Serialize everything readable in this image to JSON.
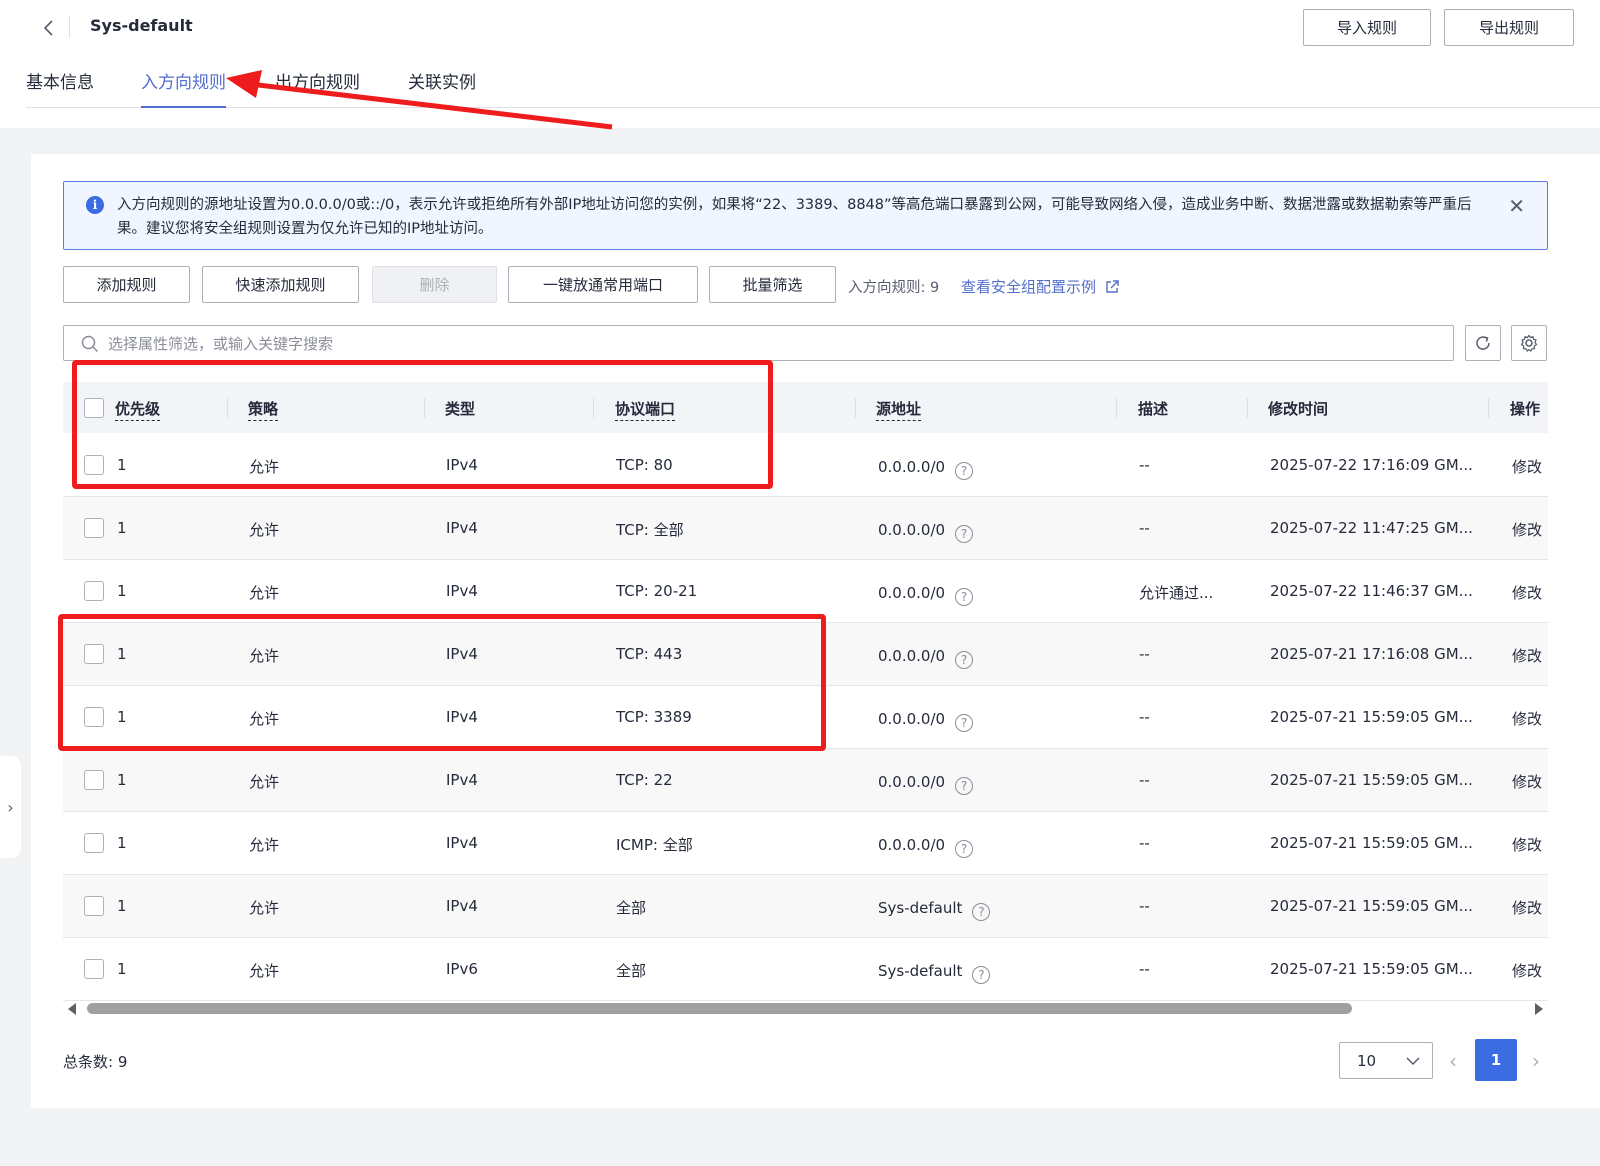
{
  "header": {
    "title": "Sys-default",
    "import_label": "导入规则",
    "export_label": "导出规则"
  },
  "tabs": [
    {
      "label": "基本信息"
    },
    {
      "label": "入方向规则"
    },
    {
      "label": "出方向规则"
    },
    {
      "label": "关联实例"
    }
  ],
  "alert": {
    "text": "入方向规则的源地址设置为0.0.0.0/0或::/0，表示允许或拒绝所有外部IP地址访问您的实例，如果将“22、3389、8848”等高危端口暴露到公网，可能导致网络入侵，造成业务中断、数据泄露或数据勒索等严重后果。建议您将安全组规则设置为仅允许已知的IP地址访问。"
  },
  "toolbar": {
    "add_label": "添加规则",
    "quick_add_label": "快速添加规则",
    "delete_label": "删除",
    "open_ports_label": "一键放通常用端口",
    "batch_filter_label": "批量筛选",
    "rule_count": "入方向规则: 9",
    "example_link": "查看安全组配置示例"
  },
  "search": {
    "placeholder": "选择属性筛选，或输入关键字搜索"
  },
  "table": {
    "columns": [
      "优先级",
      "策略",
      "类型",
      "协议端口",
      "源地址",
      "描述",
      "修改时间",
      "操作"
    ],
    "rows": [
      {
        "priority": "1",
        "policy": "允许",
        "type": "IPv4",
        "port": "TCP: 80",
        "source": "0.0.0.0/0",
        "desc": "--",
        "time": "2025-07-22 17:16:09 GM...",
        "action": "修改"
      },
      {
        "priority": "1",
        "policy": "允许",
        "type": "IPv4",
        "port": "TCP: 全部",
        "source": "0.0.0.0/0",
        "desc": "--",
        "time": "2025-07-22 11:47:25 GM...",
        "action": "修改"
      },
      {
        "priority": "1",
        "policy": "允许",
        "type": "IPv4",
        "port": "TCP: 20-21",
        "source": "0.0.0.0/0",
        "desc": "允许通过...",
        "time": "2025-07-22 11:46:37 GM...",
        "action": "修改"
      },
      {
        "priority": "1",
        "policy": "允许",
        "type": "IPv4",
        "port": "TCP: 443",
        "source": "0.0.0.0/0",
        "desc": "--",
        "time": "2025-07-21 17:16:08 GM...",
        "action": "修改"
      },
      {
        "priority": "1",
        "policy": "允许",
        "type": "IPv4",
        "port": "TCP: 3389",
        "source": "0.0.0.0/0",
        "desc": "--",
        "time": "2025-07-21 15:59:05 GM...",
        "action": "修改"
      },
      {
        "priority": "1",
        "policy": "允许",
        "type": "IPv4",
        "port": "TCP: 22",
        "source": "0.0.0.0/0",
        "desc": "--",
        "time": "2025-07-21 15:59:05 GM...",
        "action": "修改"
      },
      {
        "priority": "1",
        "policy": "允许",
        "type": "IPv4",
        "port": "ICMP: 全部",
        "source": "0.0.0.0/0",
        "desc": "--",
        "time": "2025-07-21 15:59:05 GM...",
        "action": "修改"
      },
      {
        "priority": "1",
        "policy": "允许",
        "type": "IPv4",
        "port": "全部",
        "source": "Sys-default",
        "source_link": true,
        "desc": "--",
        "time": "2025-07-21 15:59:05 GM...",
        "action": "修改"
      },
      {
        "priority": "1",
        "policy": "允许",
        "type": "IPv6",
        "port": "全部",
        "source": "Sys-default",
        "source_link": true,
        "desc": "--",
        "time": "2025-07-21 15:59:05 GM...",
        "action": "修改"
      }
    ]
  },
  "footer": {
    "total": "总条数: 9",
    "page_size": "10",
    "current_page": "1"
  },
  "colors": {
    "accent": "#526ecc",
    "primary_button": "#3b6ce2",
    "annotation_red": "#ee1c1c"
  }
}
